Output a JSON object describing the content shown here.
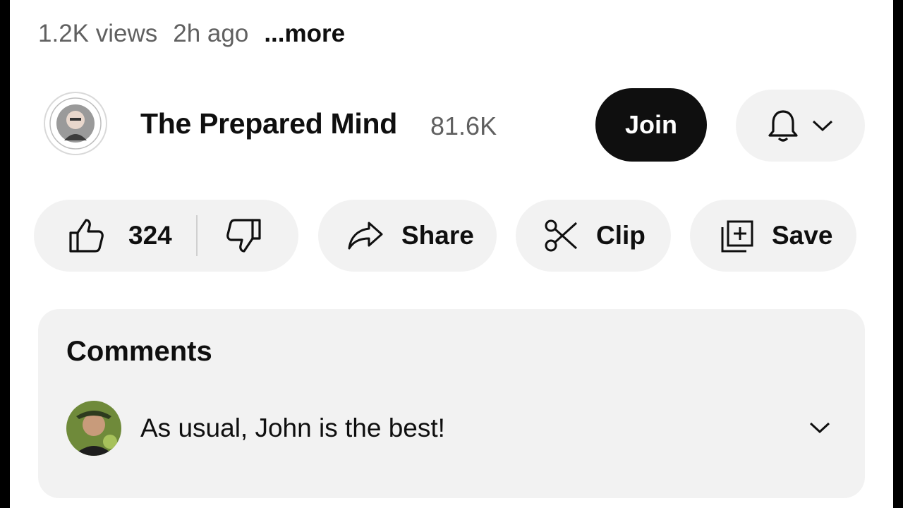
{
  "meta": {
    "views": "1.2K views",
    "age": "2h ago",
    "more": "...more"
  },
  "channel": {
    "name": "The Prepared Mind",
    "subscribers": "81.6K",
    "avatar_icon": "channel-avatar"
  },
  "actions": {
    "join_label": "Join",
    "notifications_icon": "bell-icon",
    "likes": "324",
    "share_label": "Share",
    "clip_label": "Clip",
    "save_label": "Save"
  },
  "comments": {
    "title": "Comments",
    "top_comment": "As usual, John is the best!"
  },
  "colors": {
    "accent": "#0f0f0f",
    "pill_bg": "#f2f2f2",
    "muted": "#606060"
  }
}
